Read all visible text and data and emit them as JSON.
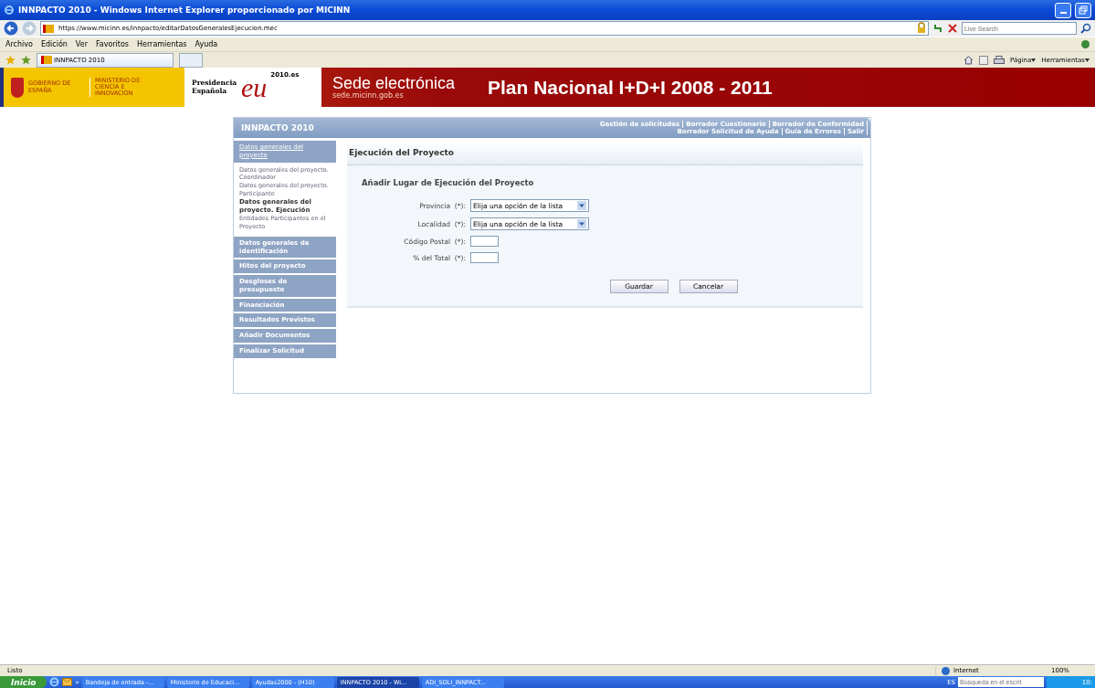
{
  "window": {
    "title": "INNPACTO 2010 - Windows Internet Explorer proporcionado por MICINN"
  },
  "address_bar": {
    "url": "https://www.micinn.es/innpacto/editarDatosGeneralesEjecucion.mec",
    "search_placeholder": "Live Search"
  },
  "menu": [
    "Archivo",
    "Edición",
    "Ver",
    "Favoritos",
    "Herramientas",
    "Ayuda"
  ],
  "tab": {
    "label": "INNPACTO 2010"
  },
  "command_bar": [
    {
      "label": "Página"
    },
    {
      "label": "Herramientas"
    }
  ],
  "banner": {
    "gov": "GOBIERNO DE ESPAÑA",
    "ministry": "MINISTERIO DE CIENCIA E INNOVACIÓN",
    "presidency": "Presidencia Española",
    "eu": "eu",
    "eu_site": "2010.es",
    "sede": "Sede electrónica",
    "sede_url": "sede.micinn.gob.es",
    "plan": "Plan Nacional I+D+I 2008 - 2011"
  },
  "app": {
    "title": "INNPACTO 2010",
    "nav_links": [
      "Gestión de solicitudes",
      "Borrador Cuestionario",
      "Borrador de Conformidad",
      "Borrador Solicitud de Ayuda",
      "Guía de Errores",
      "Salir"
    ]
  },
  "sidebar": {
    "items": [
      {
        "label": "Datos generales del proyecto",
        "expanded": true,
        "children": [
          {
            "label": "Datos generales del proyecto. Coordinador",
            "selected": false
          },
          {
            "label": "Datos generales del proyecto. Participante",
            "selected": false
          },
          {
            "label": "Datos generales del proyecto. Ejecución",
            "selected": true
          },
          {
            "label": "Entidades Participantes en el Proyecto",
            "selected": false
          }
        ]
      },
      {
        "label": "Datos generales de identificación",
        "expanded": false
      },
      {
        "label": "Hitos del proyecto",
        "expanded": false
      },
      {
        "label": "Desgloses de presupuesto",
        "expanded": false
      },
      {
        "label": "Financiación",
        "expanded": false
      },
      {
        "label": "Resultados Previstos",
        "expanded": false
      },
      {
        "label": "Añadir Documentos",
        "expanded": false
      },
      {
        "label": "Finalizar Solicitud",
        "expanded": false
      }
    ]
  },
  "content": {
    "title": "Ejecución del Proyecto",
    "subtitle": "Añadir Lugar de Ejecución del Proyecto",
    "fields": [
      {
        "kind": "select",
        "label": "Provincia  (*):",
        "value": "Elija una opción de la lista"
      },
      {
        "kind": "select",
        "label": "Localidad  (*):",
        "value": "Elija una opción de la lista"
      },
      {
        "kind": "text",
        "label": "Código Postal  (*):"
      },
      {
        "kind": "text",
        "label": "% del Total  (*):"
      }
    ],
    "buttons": [
      "Guardar",
      "Cancelar"
    ]
  },
  "status_bar": {
    "text": "Listo",
    "zone": "Internet",
    "zoom": "100%"
  },
  "taskbar": {
    "start": "Inicio",
    "more": "»",
    "tasks": [
      {
        "label": "Bandeja de entrada -...",
        "selected": false
      },
      {
        "label": "Ministerio de Educaci...",
        "selected": false
      },
      {
        "label": "Ayudas2000 - (H10)",
        "selected": false
      },
      {
        "label": "INNPACTO 2010 - Wi...",
        "selected": true
      },
      {
        "label": "ADI_SOLI_INNPACT...",
        "selected": false
      }
    ],
    "language": "ES",
    "search_placeholder": "Búsqueda en el escrit",
    "clock": "10:"
  }
}
